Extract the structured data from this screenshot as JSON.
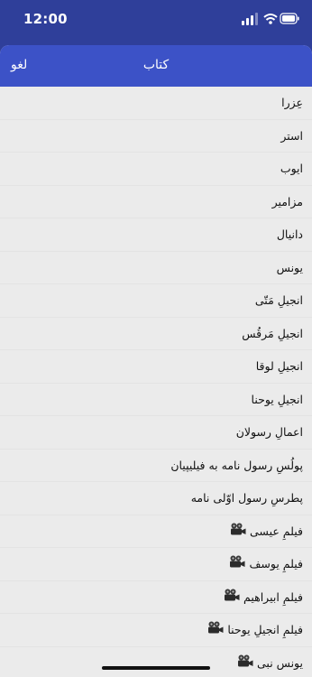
{
  "status_bar": {
    "time": "12:00"
  },
  "header": {
    "cancel_label": "لغو",
    "title": "کتاب"
  },
  "list": {
    "items": [
      {
        "label": "عِزرا",
        "icon": ""
      },
      {
        "label": "استر",
        "icon": ""
      },
      {
        "label": "ایوب",
        "icon": ""
      },
      {
        "label": "مزامیر",
        "icon": ""
      },
      {
        "label": "دانیال",
        "icon": ""
      },
      {
        "label": "یونس",
        "icon": ""
      },
      {
        "label": "انجیلِ مَتّی",
        "icon": ""
      },
      {
        "label": "انجیلِ مَرقُس",
        "icon": ""
      },
      {
        "label": "انجیلِ لوقا",
        "icon": ""
      },
      {
        "label": "انجیلِ یوحنا",
        "icon": ""
      },
      {
        "label": "اعمالِ رسولان",
        "icon": ""
      },
      {
        "label": "پولُسِ رسول نامه به فیلیپیان",
        "icon": ""
      },
      {
        "label": "پطرسِ رسول اوّلی نامه",
        "icon": ""
      },
      {
        "label": "فیلمِ عیسی",
        "icon": "film-camera-icon"
      },
      {
        "label": "فیلمِ یوسف",
        "icon": "film-camera-icon"
      },
      {
        "label": "فیلمِ ابیراهیم",
        "icon": "film-camera-icon"
      },
      {
        "label": "فیلمِ انجیلِ یوحنا",
        "icon": "film-camera-icon"
      },
      {
        "label": "یونس نبی",
        "icon": "film-camera-icon"
      }
    ]
  }
}
